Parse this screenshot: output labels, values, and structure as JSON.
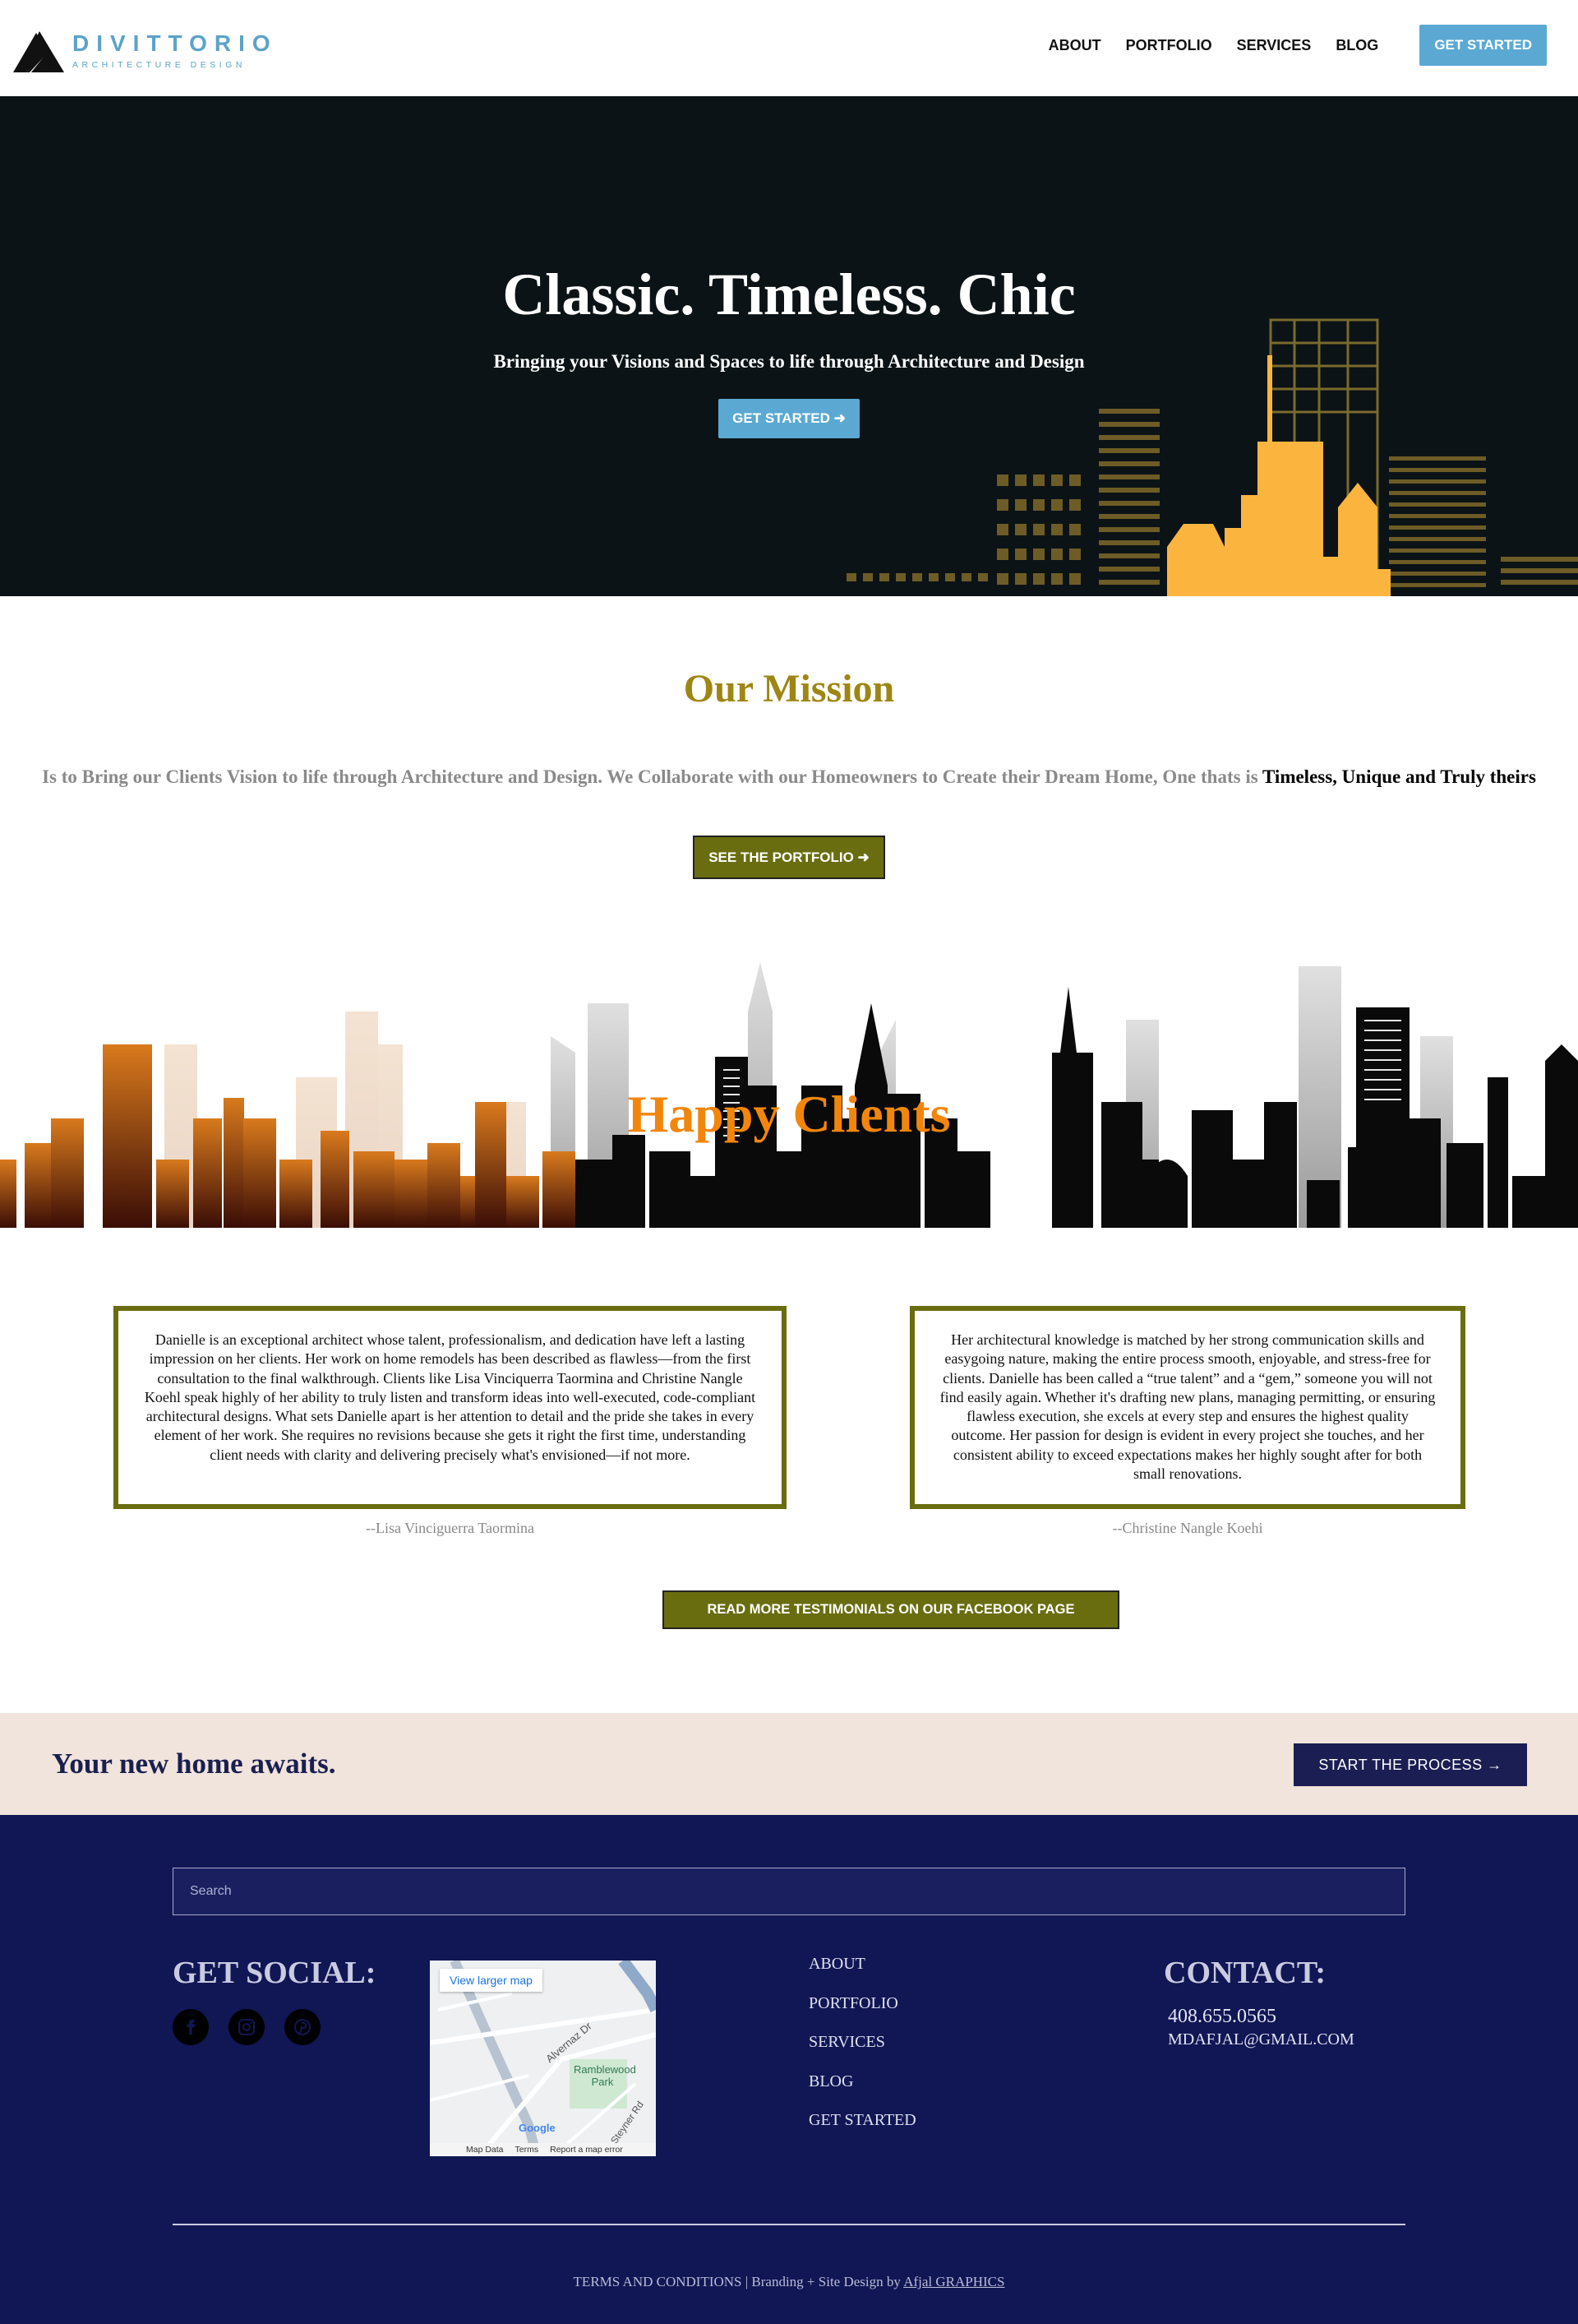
{
  "header": {
    "logo_name": "DIVITTORIO",
    "logo_tagline": "ARCHITECTURE DESIGN",
    "nav": [
      "ABOUT",
      "PORTFOLIO",
      "SERVICES",
      "BLOG"
    ],
    "cta": "GET STARTED"
  },
  "hero": {
    "title": "Classic. Timeless. Chic",
    "subtitle": "Bringing your Visions and Spaces to life through Architecture and Design",
    "button": "GET STARTED ➜"
  },
  "mission": {
    "title": "Our Mission",
    "text": "Is to Bring our Clients Vision to life through Architecture and Design. We Collaborate with our Homeowners to Create their Dream Home, One thats is ",
    "emphasis": "Timeless, Unique and Truly theirs",
    "button": "SEE THE PORTFOLIO ➜"
  },
  "clients": {
    "title": "Happy Clients",
    "testimonials": [
      {
        "text": "Danielle is an exceptional architect whose talent, professionalism, and dedication have left a lasting impression on her clients. Her work on home remodels has been described as flawless—from the first consultation to the final walkthrough. Clients like Lisa Vinciquerra Taormina and Christine Nangle Koehl speak highly of her ability to truly listen and transform ideas into well-executed, code-compliant architectural designs. What sets Danielle apart is her attention to detail and the pride she takes in every element of her work. She requires no revisions because she gets it right the first time, understanding client needs with clarity and delivering precisely what's envisioned—if not more.",
        "author": "--Lisa Vinciguerra Taormina"
      },
      {
        "text": "Her architectural knowledge is matched by her strong communication skills and easygoing nature, making the entire process smooth, enjoyable, and stress-free for clients. Danielle has been called a “true talent” and a “gem,” someone you will not find easily again. Whether it's drafting new plans, managing permitting, or ensuring flawless execution, she excels at every step and ensures the highest quality outcome. Her passion for design is evident in every project she touches, and her consistent ability to exceed expectations makes her highly sought after for both small renovations.",
        "author": "--Christine Nangle Koehi"
      }
    ],
    "button": "READ MORE TESTIMONIALS ON OUR FACEBOOK PAGE"
  },
  "band": {
    "text": "Your new home awaits.",
    "button": "START THE PROCESS →"
  },
  "footer": {
    "search_placeholder": "Search",
    "social_title": "GET SOCIAL:",
    "social_icons": [
      "facebook-icon",
      "instagram-icon",
      "pinterest-icon"
    ],
    "map": {
      "link": "View larger map",
      "labels": [
        "Alvernaz Dr",
        "Ramblewood Park",
        "Steyner Rd"
      ],
      "footer": [
        "Map Data",
        "Terms",
        "Report a map error"
      ],
      "brand": "Google"
    },
    "links": [
      "ABOUT",
      "PORTFOLIO",
      "SERVICES",
      "BLOG",
      "GET STARTED"
    ],
    "contact_title": "CONTACT:",
    "phone": "408.655.0565",
    "email": "MDAFJAL@GMAIL.COM",
    "legal_text": "TERMS AND CONDITIONS | Branding + Site Design by ",
    "legal_link": "Afjal GRAPHICS"
  },
  "colors": {
    "accent_blue": "#5ba9d3",
    "olive": "#6a6d0f",
    "gold_title": "#9e8614",
    "orange_title": "#f2860b",
    "navy": "#111655",
    "band_bg": "#f1e4dc"
  }
}
